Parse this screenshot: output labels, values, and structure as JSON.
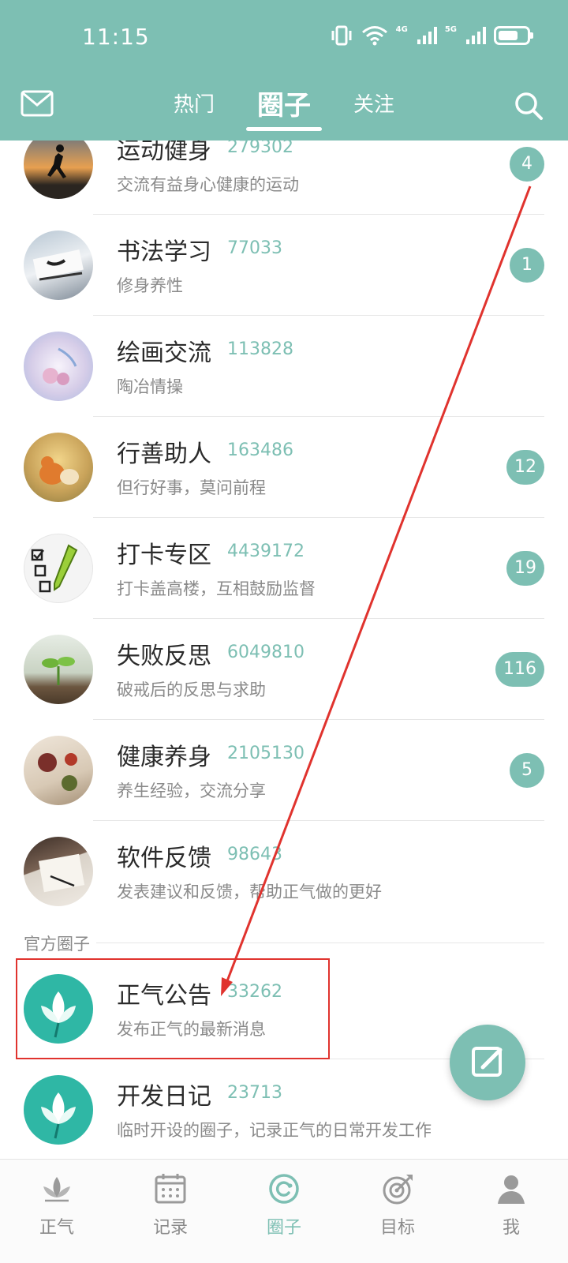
{
  "status_bar": {
    "time": "11:15",
    "signal1_label": "4G",
    "signal2_label": "5G"
  },
  "header": {
    "tabs": [
      {
        "label": "热门",
        "active": false
      },
      {
        "label": "圈子",
        "active": true
      },
      {
        "label": "关注",
        "active": false
      }
    ]
  },
  "circles": [
    {
      "name": "运动健身",
      "count": "279302",
      "desc": "交流有益身心健康的运动",
      "badge": "4"
    },
    {
      "name": "书法学习",
      "count": "77033",
      "desc": "修身养性",
      "badge": "1"
    },
    {
      "name": "绘画交流",
      "count": "113828",
      "desc": "陶冶情操",
      "badge": ""
    },
    {
      "name": "行善助人",
      "count": "163486",
      "desc": "但行好事，莫问前程",
      "badge": "12"
    },
    {
      "name": "打卡专区",
      "count": "4439172",
      "desc": "打卡盖高楼，互相鼓励监督",
      "badge": "19"
    },
    {
      "name": "失败反思",
      "count": "6049810",
      "desc": "破戒后的反思与求助",
      "badge": "116"
    },
    {
      "name": "健康养身",
      "count": "2105130",
      "desc": "养生经验，交流分享",
      "badge": "5"
    },
    {
      "name": "软件反馈",
      "count": "98643",
      "desc": "发表建议和反馈，帮助正气做的更好",
      "badge": ""
    }
  ],
  "official_section": {
    "label": "官方圈子",
    "items": [
      {
        "name": "正气公告",
        "count": "33262",
        "desc": "发布正气的最新消息"
      },
      {
        "name": "开发日记",
        "count": "23713",
        "desc": "临时开设的圈子，记录正气的日常开发工作"
      }
    ]
  },
  "tabbar": [
    {
      "label": "正气",
      "icon": "lotus-icon",
      "active": false
    },
    {
      "label": "记录",
      "icon": "calendar-icon",
      "active": false
    },
    {
      "label": "圈子",
      "icon": "circle-icon",
      "active": true
    },
    {
      "label": "目标",
      "icon": "target-icon",
      "active": false
    },
    {
      "label": "我",
      "icon": "person-icon",
      "active": false
    }
  ],
  "colors": {
    "accent": "#7dbfb3",
    "annotation": "#e0332e"
  }
}
